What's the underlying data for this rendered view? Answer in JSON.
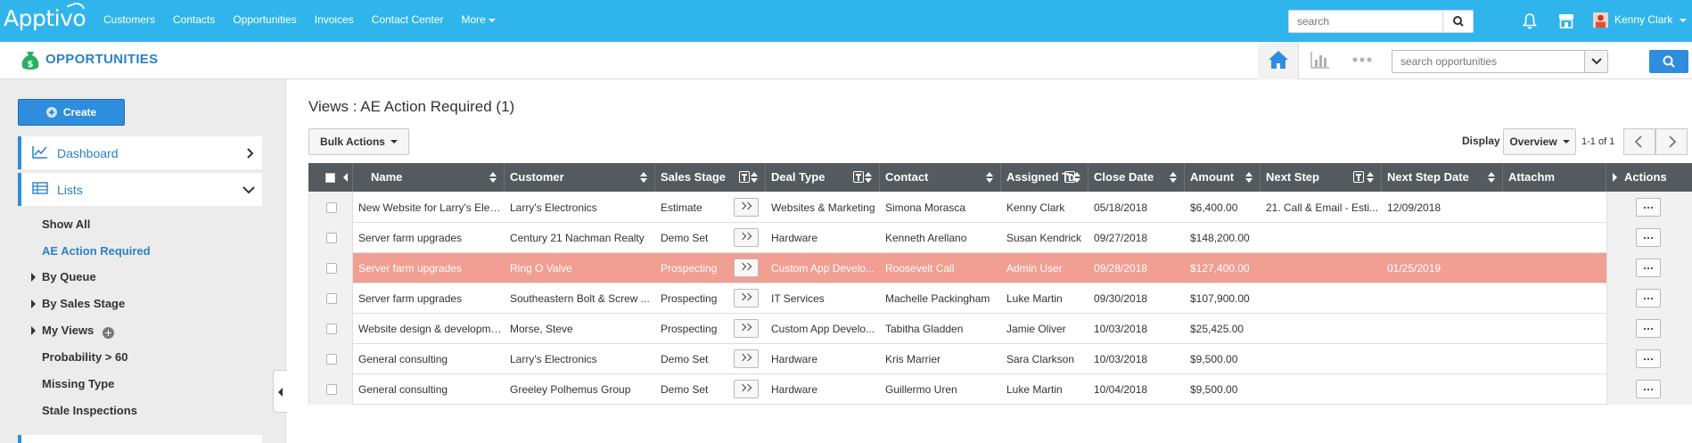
{
  "topbar": {
    "logo": "Apptivo",
    "nav": [
      "Customers",
      "Contacts",
      "Opportunities",
      "Invoices",
      "Contact Center",
      "More"
    ],
    "search_placeholder": "search",
    "user_name": "Kenny Clark"
  },
  "app_header": {
    "title": "OPPORTUNITIES",
    "search_placeholder": "search opportunities"
  },
  "sidebar": {
    "create_label": "Create",
    "panels": [
      {
        "label": "Dashboard",
        "icon": "line-chart-icon"
      },
      {
        "label": "Lists",
        "icon": "table-icon"
      }
    ],
    "list_items": [
      {
        "label": "Show All",
        "expandable": false,
        "active": false
      },
      {
        "label": "AE Action Required",
        "expandable": false,
        "active": true
      },
      {
        "label": "By Queue",
        "expandable": true,
        "active": false
      },
      {
        "label": "By Sales Stage",
        "expandable": true,
        "active": false
      },
      {
        "label": "My Views",
        "expandable": true,
        "active": false
      },
      {
        "label": "Probability > 60",
        "expandable": false,
        "active": false
      },
      {
        "label": "Missing Type",
        "expandable": false,
        "active": false
      },
      {
        "label": "Stale Inspections",
        "expandable": false,
        "active": false
      }
    ]
  },
  "main": {
    "view_title": "Views : AE Action Required (1)",
    "bulk_actions_label": "Bulk Actions",
    "display_label": "Display",
    "display_value": "Overview",
    "page_info": "1-1 of 1"
  },
  "grid": {
    "columns": [
      "Name",
      "Customer",
      "Sales Stage",
      "Deal Type",
      "Contact",
      "Assigned To",
      "Close Date",
      "Amount",
      "Next Step",
      "Next Step Date",
      "Attachm",
      "Actions"
    ],
    "rows": [
      {
        "name": "New Website for Larry's Electronics",
        "customer": "Larry's Electronics",
        "stage": "Estimate",
        "deal_type": "Websites & Marketing",
        "contact": "Simona Morasca",
        "assigned": "Kenny Clark",
        "close_date": "05/18/2018",
        "amount": "$6,400.00",
        "next_step": "21. Call & Email - Esti...",
        "next_step_date": "12/09/2018",
        "highlight": false
      },
      {
        "name": "Server farm upgrades",
        "customer": "Century 21 Nachman Realty",
        "stage": "Demo Set",
        "deal_type": "Hardware",
        "contact": "Kenneth Arellano",
        "assigned": "Susan Kendrick",
        "close_date": "09/27/2018",
        "amount": "$148,200.00",
        "next_step": "",
        "next_step_date": "",
        "highlight": false
      },
      {
        "name": "Server farm upgrades",
        "customer": "Ring O Valve",
        "stage": "Prospecting",
        "deal_type": "Custom App Develo...",
        "contact": "Roosevelt Call",
        "assigned": "Admin User",
        "close_date": "09/28/2018",
        "amount": "$127,400.00",
        "next_step": "",
        "next_step_date": "01/25/2019",
        "highlight": true
      },
      {
        "name": "Server farm upgrades",
        "customer": "Southeastern Bolt & Screw ...",
        "stage": "Prospecting",
        "deal_type": "IT Services",
        "contact": "Machelle Packingham",
        "assigned": "Luke Martin",
        "close_date": "09/30/2018",
        "amount": "$107,900.00",
        "next_step": "",
        "next_step_date": "",
        "highlight": false
      },
      {
        "name": "Website design & development",
        "customer": "Morse, Steve",
        "stage": "Prospecting",
        "deal_type": "Custom App Develo...",
        "contact": "Tabitha Gladden",
        "assigned": "Jamie Oliver",
        "close_date": "10/03/2018",
        "amount": "$25,425.00",
        "next_step": "",
        "next_step_date": "",
        "highlight": false
      },
      {
        "name": "General consulting",
        "customer": "Larry's Electronics",
        "stage": "Demo Set",
        "deal_type": "Hardware",
        "contact": "Kris Marrier",
        "assigned": "Sara Clarkson",
        "close_date": "10/03/2018",
        "amount": "$9,500.00",
        "next_step": "",
        "next_step_date": "",
        "highlight": false
      },
      {
        "name": "General consulting",
        "customer": "Greeley Polhemus Group",
        "stage": "Demo Set",
        "deal_type": "Hardware",
        "contact": "Guillermo Uren",
        "assigned": "Luke Martin",
        "close_date": "10/04/2018",
        "amount": "$9,500.00",
        "next_step": "",
        "next_step_date": "",
        "highlight": false
      }
    ]
  },
  "colors": {
    "topbar": "#2fb5ec",
    "accent": "#2e8ddd",
    "header_dark": "#555a5e",
    "highlight_row": "#f09f92"
  }
}
